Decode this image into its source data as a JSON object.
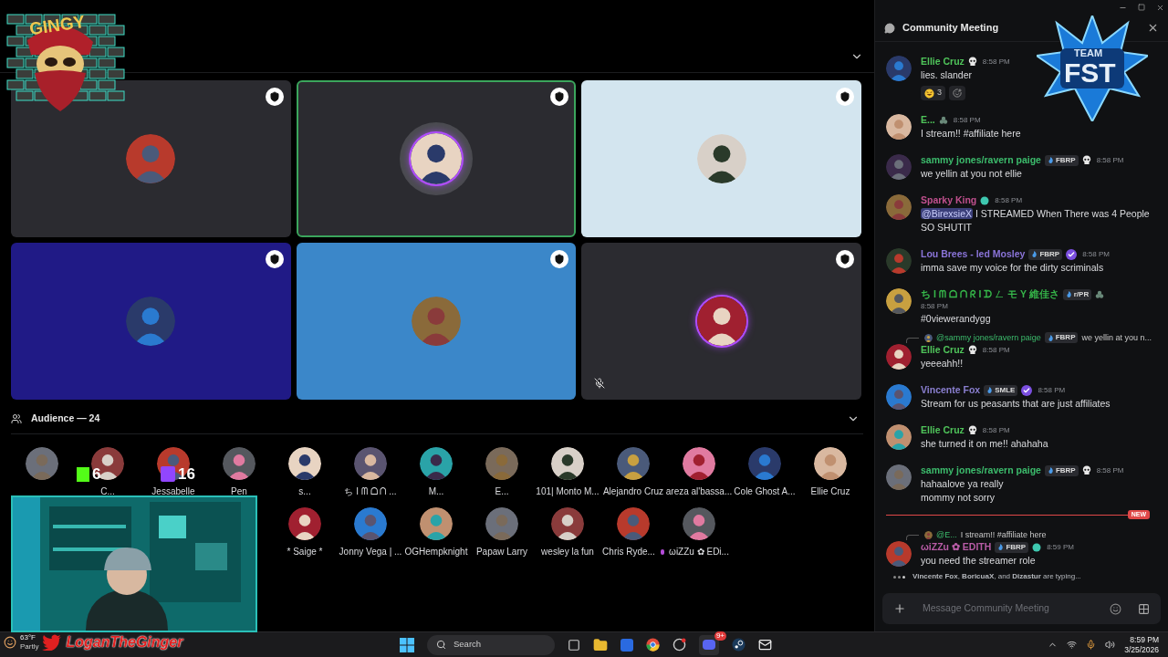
{
  "stage": {
    "tiles": [
      {
        "color": "#2b2b30",
        "speaking": false,
        "muted": false
      },
      {
        "color": "#2b2b30",
        "speaking": true,
        "muted": false
      },
      {
        "color": "#d3e5ef",
        "speaking": false,
        "muted": false
      },
      {
        "color": "#201a86",
        "speaking": false,
        "muted": false
      },
      {
        "color": "#3b87c9",
        "speaking": false,
        "muted": false
      },
      {
        "color": "#2b2b30",
        "speaking": false,
        "muted": true
      }
    ]
  },
  "audience": {
    "title": "Audience — 24",
    "rows": [
      [
        {},
        {
          "name": "C..."
        },
        {
          "name": "Jessabelle"
        },
        {
          "name": "Pen"
        },
        {
          "name": "s..."
        },
        {
          "name": "ち I ᗰ ᗝ ᑎ ..."
        },
        {
          "name": "M..."
        },
        {
          "name": "E..."
        },
        {
          "name": "101| Monto M..."
        },
        {
          "name": "Alejandro Cruz"
        },
        {
          "name": "areza al'bassa..."
        },
        {
          "name": "Cole Ghost A..."
        },
        {
          "name": "Ellie Cruz"
        }
      ],
      [
        "",
        "",
        "",
        "",
        {
          "name": "* Saige *"
        },
        {
          "name": "Jonny Vega | ..."
        },
        {
          "name": "OGHempknight"
        },
        {
          "name": "Papaw Larry"
        },
        {
          "name": "wesley la fun"
        },
        {
          "name": "Chris Ryde...",
          "dot": true
        },
        {
          "name": "ωiZZu ✿ EDi..."
        }
      ]
    ]
  },
  "chat": {
    "title": "Community Meeting",
    "messages": [
      {
        "kind": "message",
        "author": "Ellie Cruz",
        "color": "#4fc45a",
        "badges": [
          {
            "kind": "skull"
          }
        ],
        "time": "8:58 PM",
        "lines": [
          "lies. slander"
        ],
        "reactions": [
          {
            "count": "3"
          }
        ]
      },
      {
        "kind": "message",
        "author": "E...",
        "color": "#4fc45a",
        "badges": [
          {
            "kind": "emblem"
          }
        ],
        "time": "8:58 PM",
        "lines": [
          "I stream!! #affiliate here"
        ]
      },
      {
        "kind": "message",
        "author": "sammy jones/ravern paige",
        "color": "#3cbc6c",
        "badges": [
          {
            "kind": "tag",
            "label": "FBRP"
          },
          {
            "kind": "skull"
          }
        ],
        "time": "8:58 PM",
        "lines": [
          "we yellin at you not ellie"
        ]
      },
      {
        "kind": "message",
        "author": "Sparky King",
        "color": "#c0508e",
        "badges": [
          {
            "kind": "gem"
          }
        ],
        "time": "8:58 PM",
        "mention": "@BirexsieX",
        "lines": [
          "I STREAMED When There was 4 People",
          "SO SHUTIT"
        ]
      },
      {
        "kind": "message",
        "author": "Lou Brees - led Mosley",
        "color": "#8a74d8",
        "badges": [
          {
            "kind": "tag",
            "label": "FBRP"
          },
          {
            "kind": "verified"
          }
        ],
        "time": "8:58 PM",
        "lines": [
          "imma save my voice for the dirty scriminals"
        ]
      },
      {
        "kind": "message",
        "author": "ち I ᗰ ᗝ ᑎ  ᖇ I ᗪ ㄥ モ Y 維佳さ",
        "color": "#36b84a",
        "badges": [
          {
            "kind": "tag",
            "label": "r/PR"
          },
          {
            "kind": "emblem"
          }
        ],
        "time": "8:58 PM",
        "time_below": true,
        "lines": [
          "#0viewerandygg"
        ]
      },
      {
        "kind": "message",
        "reply": {
          "mention": "@sammy jones/ravern paige",
          "tag": "FBRP",
          "text": "we yellin at you n..."
        },
        "author": "Ellie Cruz",
        "color": "#4fc45a",
        "badges": [
          {
            "kind": "skull"
          }
        ],
        "time": "8:58 PM",
        "lines": [
          "yeeeahh!!"
        ]
      },
      {
        "kind": "message",
        "author": "Vincente Fox",
        "color": "#8a7fd0",
        "badges": [
          {
            "kind": "tag",
            "label": "SMLE"
          },
          {
            "kind": "verified"
          }
        ],
        "time": "8:58 PM",
        "lines": [
          "Stream for us peasants that are just affiliates"
        ]
      },
      {
        "kind": "message",
        "author": "Ellie Cruz",
        "color": "#4fc45a",
        "badges": [
          {
            "kind": "skull"
          }
        ],
        "time": "8:58 PM",
        "lines": [
          "she turned it on me!! ahahaha"
        ]
      },
      {
        "kind": "message",
        "author": "sammy jones/ravern paige",
        "color": "#3cbc6c",
        "badges": [
          {
            "kind": "tag",
            "label": "FBRP"
          },
          {
            "kind": "skull"
          }
        ],
        "time": "8:58 PM",
        "lines": [
          "hahaalove ya really",
          "mommy not sorry"
        ]
      },
      {
        "kind": "divider",
        "label": "NEW"
      },
      {
        "kind": "message",
        "reply": {
          "mention": "@E...",
          "text": "I stream!! #affiliate here"
        },
        "author": "ωiZZu ✿ EDITH",
        "color": "#b85ca6",
        "badges": [
          {
            "kind": "tag",
            "label": "FBRP"
          },
          {
            "kind": "gem"
          }
        ],
        "time": "8:59 PM",
        "lines": [
          "you need the streamer role"
        ]
      }
    ],
    "typing": "**Vincente Fox**, **BoricuaX**, and **Dizastur** are typing...",
    "input": {
      "placeholder": "Message Community Meeting"
    }
  },
  "overlay": {
    "logo_text": "GINGY",
    "kick_viewers": "6",
    "twitch_viewers": "16",
    "handle": "LoganTheGinger",
    "team_top": "TEAM",
    "team_main": "FST"
  },
  "taskbar": {
    "weather_temp": "63°F",
    "weather_text": "Partly",
    "search": {
      "placeholder": "Search"
    },
    "discord_badge": "9+",
    "time": "8:59 PM",
    "date": "3/25/2026"
  }
}
